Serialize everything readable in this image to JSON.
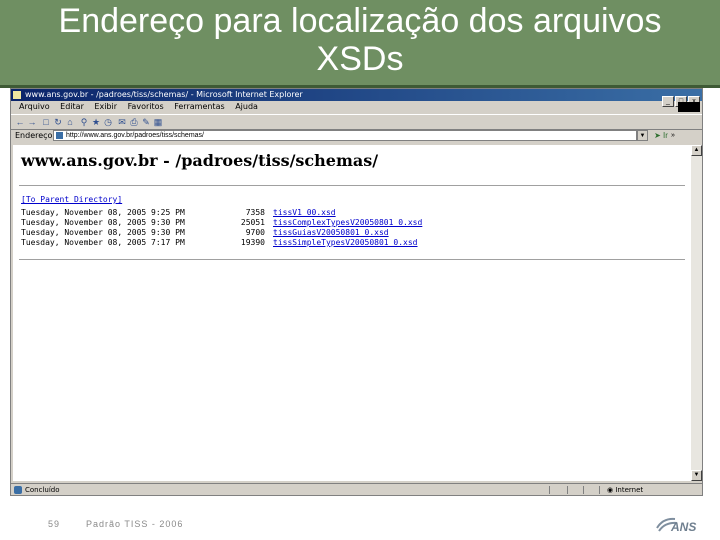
{
  "slide": {
    "title_line1": "Endereço para localização dos arquivos",
    "title_line2": "XSDs",
    "page_number": "59",
    "footer": "Padrão TISS - 2006",
    "colors": {
      "header": "#6f8f62",
      "header_rule": "#3e5a35"
    }
  },
  "browser": {
    "window_title": "www.ans.gov.br - /padroes/tiss/schemas/ - Microsoft Internet Explorer",
    "window_buttons": [
      "_",
      "□",
      "x"
    ],
    "menu": [
      "Arquivo",
      "Editar",
      "Exibir",
      "Favoritos",
      "Ferramentas",
      "Ajuda"
    ],
    "toolbar_icons": [
      "back-icon",
      "forward-icon",
      "stop-icon",
      "refresh-icon",
      "home-icon",
      "search-icon",
      "favorites-icon",
      "history-icon",
      "mail-icon",
      "print-icon",
      "edit-icon",
      "discuss-icon"
    ],
    "address_label": "Endereço",
    "address_value": "http://www.ans.gov.br/padroes/tiss/schemas/",
    "go_label": "Ir",
    "links_label": "»",
    "status_text": "Concluído",
    "status_zone": "Internet"
  },
  "page": {
    "heading": "www.ans.gov.br - /padroes/tiss/schemas/",
    "parent_link": "[To Parent Directory]",
    "files": [
      {
        "date": "Tuesday, November 08, 2005  9:25 PM",
        "size": "7358",
        "name": "tissV1_00.xsd"
      },
      {
        "date": "Tuesday, November 08, 2005  9:30 PM",
        "size": "25051",
        "name": "tissComplexTypesV20050801_0.xsd"
      },
      {
        "date": "Tuesday, November 08, 2005  9:30 PM",
        "size": "9700",
        "name": "tissGuiasV20050801_0.xsd"
      },
      {
        "date": "Tuesday, November 08, 2005  7:17 PM",
        "size": "19390",
        "name": "tissSimpleTypesV20050801_0.xsd"
      }
    ]
  }
}
